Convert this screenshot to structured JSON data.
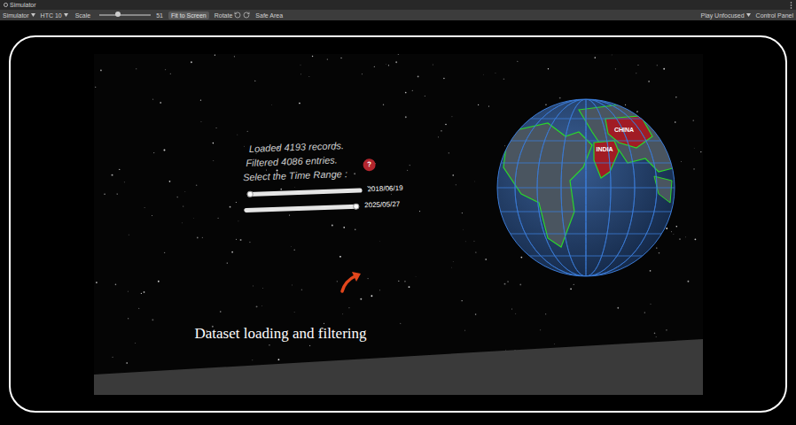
{
  "window": {
    "title": "Simulator"
  },
  "toolbar": {
    "device_menu": "Simulator",
    "device": "HTC 10",
    "scale_label": "Scale",
    "scale_level": 0.35,
    "scale_value": "51",
    "fit_button": "Fit to Screen",
    "rotate_label": "Rotate",
    "safe_area": "Safe Area",
    "play_mode": "Play Unfocused",
    "control_panel": "Control Panel"
  },
  "scene": {
    "status_lines": [
      "Loaded 4193 records.",
      "Filtered 4086 entries.",
      "Select the Time Range :"
    ],
    "help": "?",
    "sliders": [
      {
        "level": 0.03,
        "date": "2018/06/19"
      },
      {
        "level": 0.97,
        "date": "2025/05/27"
      }
    ],
    "globe": {
      "labels": [
        {
          "text": "CHINA",
          "highlighted": true
        },
        {
          "text": "INDIA",
          "highlighted": true
        }
      ]
    },
    "caption": "Dataset loading and filtering"
  }
}
